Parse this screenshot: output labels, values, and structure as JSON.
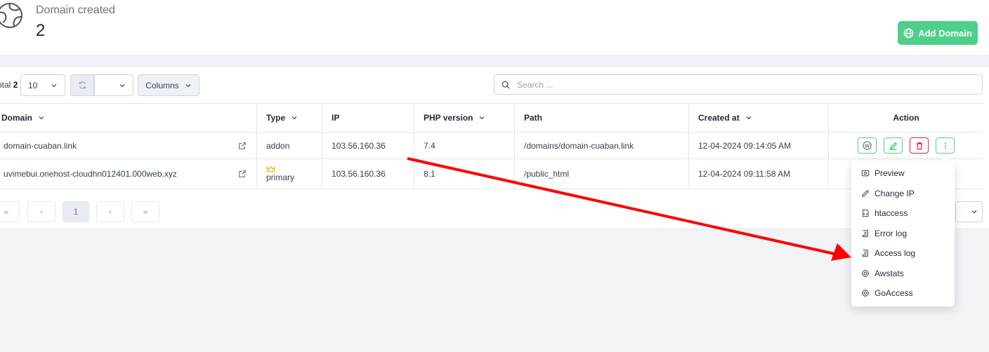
{
  "stat": {
    "label": "Domain created",
    "value": "2"
  },
  "add_domain": {
    "label": "Add Domain"
  },
  "toolbar": {
    "total_prefix": "otal",
    "total_value": "2",
    "page_size": "10",
    "columns_label": "Columns",
    "search_placeholder": "Search ..."
  },
  "table": {
    "headers": [
      "Domain",
      "Type",
      "IP",
      "PHP version",
      "Path",
      "Created at",
      "Action"
    ],
    "rows": [
      {
        "domain": "domain-cuaban.link",
        "type": "addon",
        "ip": "103.56.160.36",
        "php": "7.4",
        "path": "/domains/domain-cuaban.link",
        "created": "12-04-2024 09:14:05 AM"
      },
      {
        "domain": "uvimebui.onehost-cloudhn012401.000web.xyz",
        "type": "primary",
        "ip": "103.56.160.36",
        "php": "8.1",
        "path": "/public_html",
        "created": "12-04-2024 09:11:58 AM"
      }
    ]
  },
  "pagination": {
    "first": "«",
    "prev": "‹",
    "current": "1",
    "next": "›",
    "last": "»"
  },
  "menu": {
    "items": [
      {
        "label": "Preview",
        "icon": "preview-icon"
      },
      {
        "label": "Change IP",
        "icon": "pencil-icon"
      },
      {
        "label": "htaccess",
        "icon": "file-code-icon"
      },
      {
        "label": "Error log",
        "icon": "scroll-icon"
      },
      {
        "label": "Access log",
        "icon": "scroll-icon"
      },
      {
        "label": "Awstats",
        "icon": "gear-icon"
      },
      {
        "label": "GoAccess",
        "icon": "gear-icon"
      }
    ]
  },
  "colors": {
    "accent": "#4fd08a",
    "danger": "#e11d48",
    "arrow": "#ff0000"
  }
}
